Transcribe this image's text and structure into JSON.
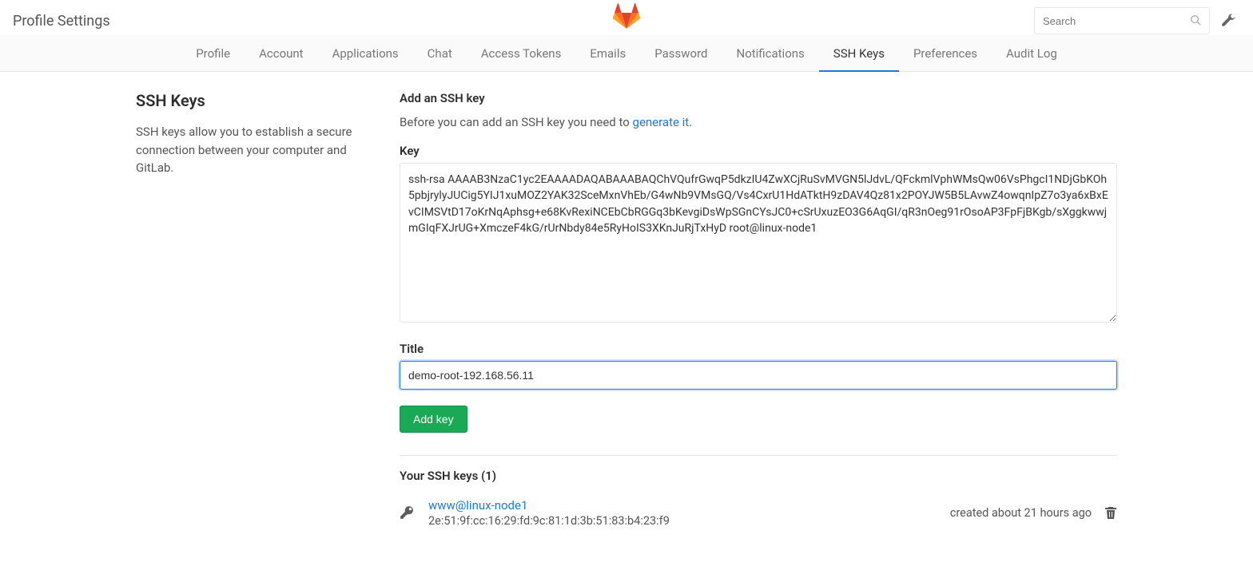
{
  "header": {
    "page_title": "Profile Settings",
    "search_placeholder": "Search"
  },
  "nav": {
    "items": [
      {
        "label": "Profile",
        "active": false
      },
      {
        "label": "Account",
        "active": false
      },
      {
        "label": "Applications",
        "active": false
      },
      {
        "label": "Chat",
        "active": false
      },
      {
        "label": "Access Tokens",
        "active": false
      },
      {
        "label": "Emails",
        "active": false
      },
      {
        "label": "Password",
        "active": false
      },
      {
        "label": "Notifications",
        "active": false
      },
      {
        "label": "SSH Keys",
        "active": true
      },
      {
        "label": "Preferences",
        "active": false
      },
      {
        "label": "Audit Log",
        "active": false
      }
    ]
  },
  "sidebar": {
    "heading": "SSH Keys",
    "desc": "SSH keys allow you to establish a secure connection between your computer and GitLab."
  },
  "form": {
    "heading": "Add an SSH key",
    "hint_prefix": "Before you can add an SSH key you need to ",
    "hint_link": "generate it",
    "hint_suffix": ".",
    "key_label": "Key",
    "key_value": "ssh-rsa AAAAB3NzaC1yc2EAAAADAQABAAABAQChVQufrGwqP5dkzIU4ZwXCjRuSvMVGN5lJdvL/QFckmlVphWMsQw06VsPhgcI1NDjGbKOh5pbjrylyJUCig5YIJ1xuMOZ2YAK32SceMxnVhEb/G4wNb9VMsGQ/Vs4CxrU1HdATktH9zDAV4Qz81x2POYJW5B5LAvwZ4owqnIpZ7o3ya6xBxEvCIMSVtD17oKrNqAphsg+e68KvRexiNCEbCbRGGq3bKevgiDsWpSGnCYsJC0+cSrUxuzEO3G6AqGI/qR3nOeg91rOsoAP3FpFjBKgb/sXggkwwjmGIqFXJrUG+XmczeF4kG/rUrNbdy84e5RyHoIS3XKnJuRjTxHyD root@linux-node1",
    "title_label": "Title",
    "title_value": "demo-root-192.168.56.11",
    "submit_label": "Add key"
  },
  "existing": {
    "heading": "Your SSH keys (1)",
    "keys": [
      {
        "name": "www@linux-node1",
        "fingerprint": "2e:51:9f:cc:16:29:fd:9c:81:1d:3b:51:83:b4:23:f9",
        "created": "created about 21 hours ago"
      }
    ]
  }
}
